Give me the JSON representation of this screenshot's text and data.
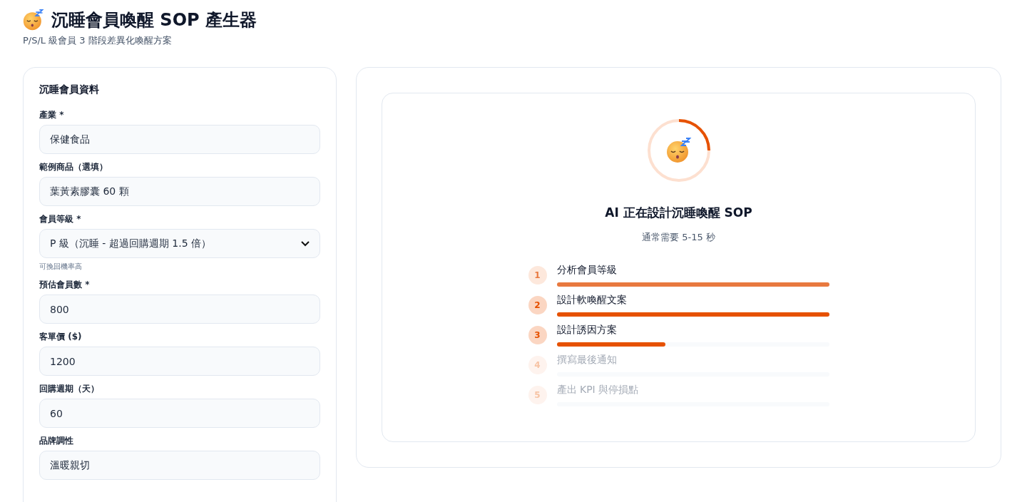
{
  "header": {
    "title": "沉睡會員喚醒 SOP 產生器",
    "subtitle": "P/S/L 級會員 3 階段差異化喚醒方案"
  },
  "form": {
    "heading": "沉睡會員資料",
    "fields": [
      {
        "kind": "input",
        "label": "產業 *",
        "value": "保健食品"
      },
      {
        "kind": "input",
        "label": "範例商品（選填）",
        "value": "葉黃素膠囊 60 顆"
      },
      {
        "kind": "select",
        "label": "會員等級 *",
        "value": "P 級（沉睡 - 超過回購週期 1.5 倍）",
        "hint": "可挽回機率高"
      },
      {
        "kind": "input",
        "label": "預估會員數 *",
        "value": "800"
      },
      {
        "kind": "input",
        "label": "客單價 ($)",
        "value": "1200"
      },
      {
        "kind": "input",
        "label": "回購週期（天）",
        "value": "60"
      },
      {
        "kind": "input",
        "label": "品牌調性",
        "value": "溫暖親切"
      }
    ]
  },
  "loading": {
    "title": "AI 正在設計沉睡喚醒 SOP",
    "note": "通常需要 5-15 秒",
    "steps": [
      {
        "number": "1",
        "label": "分析會員等級",
        "active": false,
        "level": 1
      },
      {
        "number": "2",
        "label": "設計軟喚醒文案",
        "active": true,
        "level": 1
      },
      {
        "number": "3",
        "label": "設計誘因方案",
        "active": true,
        "level": 0.4
      },
      {
        "number": "4",
        "label": "撰寫最後通知",
        "active": false
      },
      {
        "number": "5",
        "label": "產出 KPI 與停損點",
        "active": false
      }
    ]
  }
}
